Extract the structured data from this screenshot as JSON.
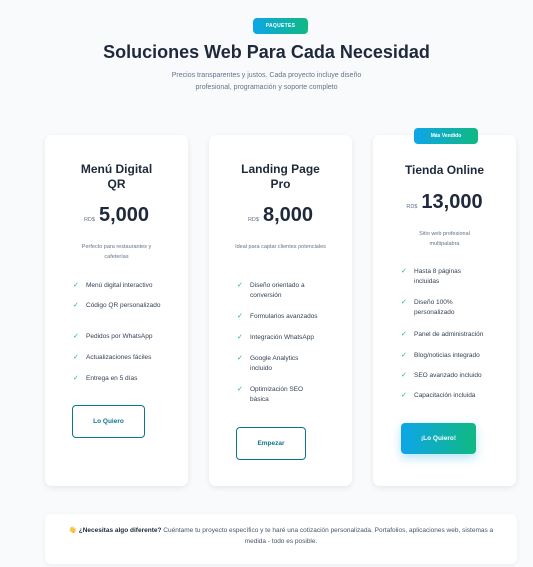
{
  "header": {
    "badge": "PAQUETES",
    "title": "Soluciones Web Para Cada Necesidad",
    "subtitle": "Precios transparentes y justos. Cada proyecto incluye diseño profesional, programación y soporte completo"
  },
  "plans": [
    {
      "name": "Menú Digital QR",
      "currency": "RD$",
      "price": "5,000",
      "description": "Perfecto para restaurantes y cafeterías",
      "features": [
        "Menú digital interactivo",
        "Código QR personalizado",
        "Pedidos por WhatsApp",
        "Actualizaciones fáciles",
        "Entrega en 5 días"
      ],
      "button": "Lo Quiero"
    },
    {
      "name": "Landing Page Pro",
      "currency": "RD$",
      "price": "8,000",
      "description": "Ideal para captar clientes potenciales",
      "features": [
        "Diseño orientado a conversión",
        "Formularios avanzados",
        "Integración WhatsApp",
        "Google Analytics incluido",
        "Optimización SEO básica"
      ],
      "button": "Empezar"
    },
    {
      "badge": "Más Vendido",
      "name": "Tienda Online",
      "currency": "RD$",
      "price": "13,000",
      "description": "Sitio web profesional multipalabra",
      "features": [
        "Hasta 8 páginas incluidas",
        "Diseño 100% personalizado",
        "Panel de administración",
        "Blog/noticias integrado",
        "SEO avanzado incluido",
        "Capacitación incluida"
      ],
      "button": "¡Lo Quiero!"
    }
  ],
  "note": {
    "icon": "👋",
    "question": "¿Necesitas algo diferente?",
    "text": "Cuéntame tu proyecto específico y te haré una cotización personalizada. Portafolios, aplicaciones web, sistemas a medida - todo es posible."
  },
  "colors": {
    "accent_start": "#0ea5e9",
    "accent_end": "#10b981",
    "check": "#10b981",
    "outline_button": "#0e7490",
    "heading": "#1e293b"
  },
  "icons": {
    "check": "check-icon",
    "note": "waving-hand-icon"
  }
}
